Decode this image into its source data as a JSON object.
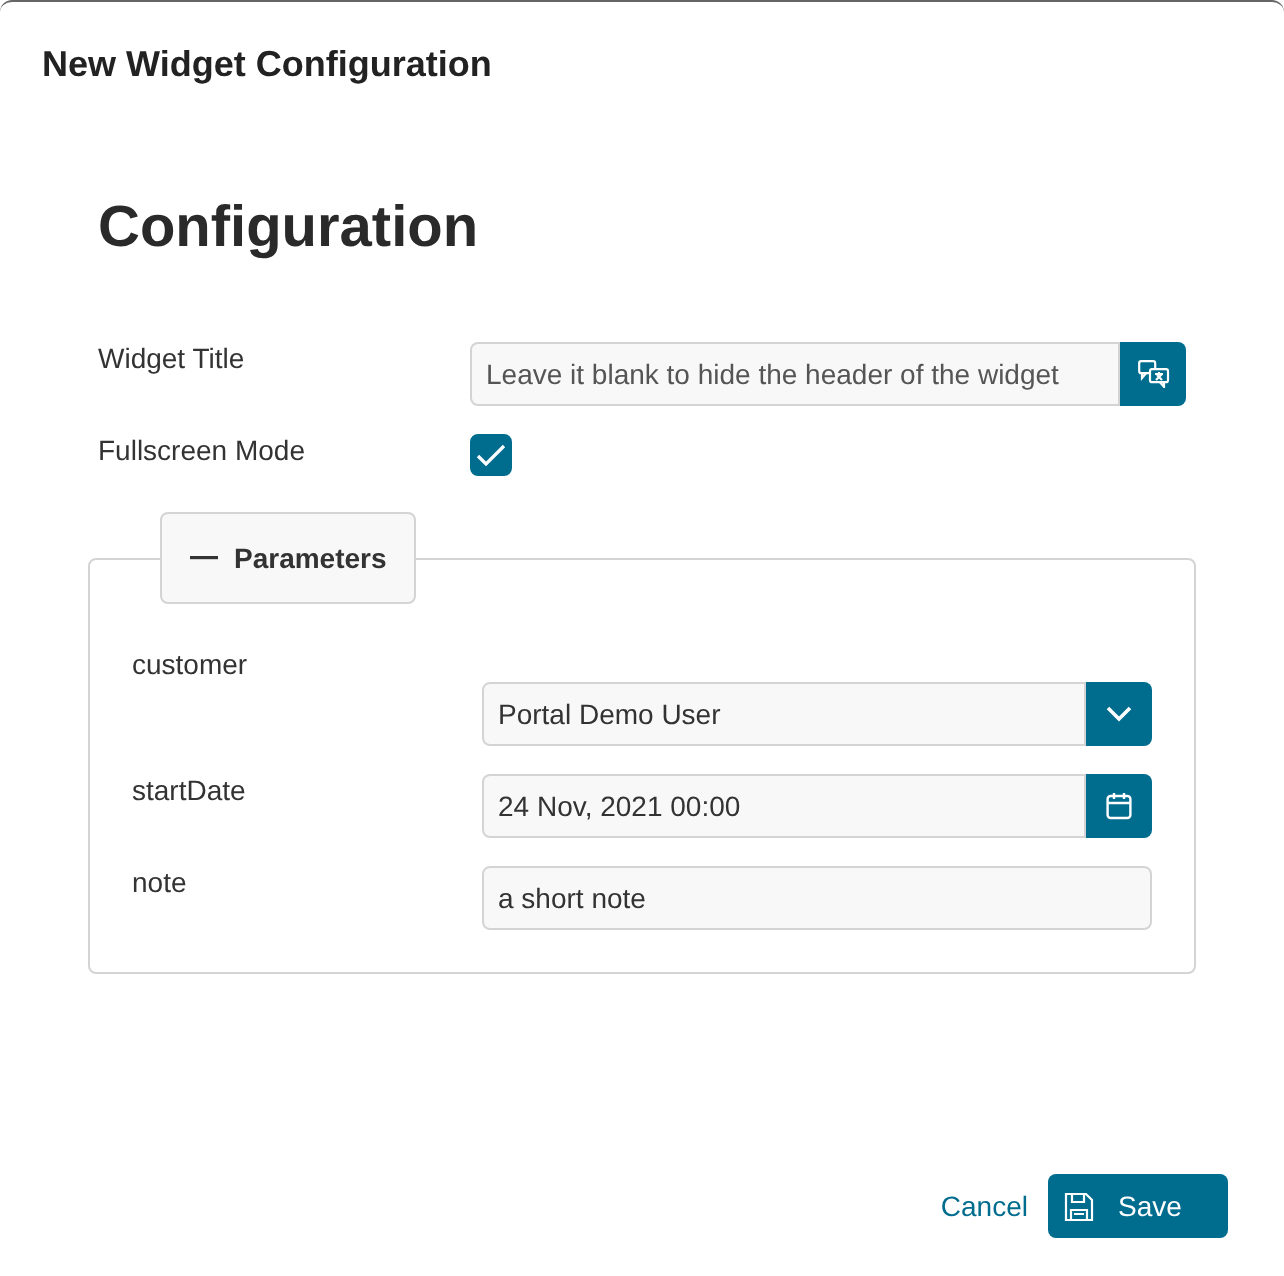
{
  "dialog": {
    "title": "New Widget Configuration"
  },
  "heading": "Configuration",
  "fields": [
    {
      "label": "Widget Title",
      "kind": "translatable",
      "placeholder": "Leave it blank to hide the header of the widget"
    },
    {
      "label": "Fullscreen Mode",
      "kind": "checkbox",
      "checked": true
    }
  ],
  "parameters": {
    "title": "Parameters",
    "expanded": true,
    "fields": [
      {
        "label": "customer",
        "kind": "select",
        "value": "Portal Demo User"
      },
      {
        "label": "startDate",
        "kind": "date",
        "value": "24 Nov, 2021 00:00"
      },
      {
        "label": "note",
        "kind": "text",
        "value": "a short note"
      }
    ]
  },
  "buttons": [
    {
      "label": "Cancel",
      "kind": "link"
    },
    {
      "label": "Save",
      "kind": "primary"
    }
  ]
}
